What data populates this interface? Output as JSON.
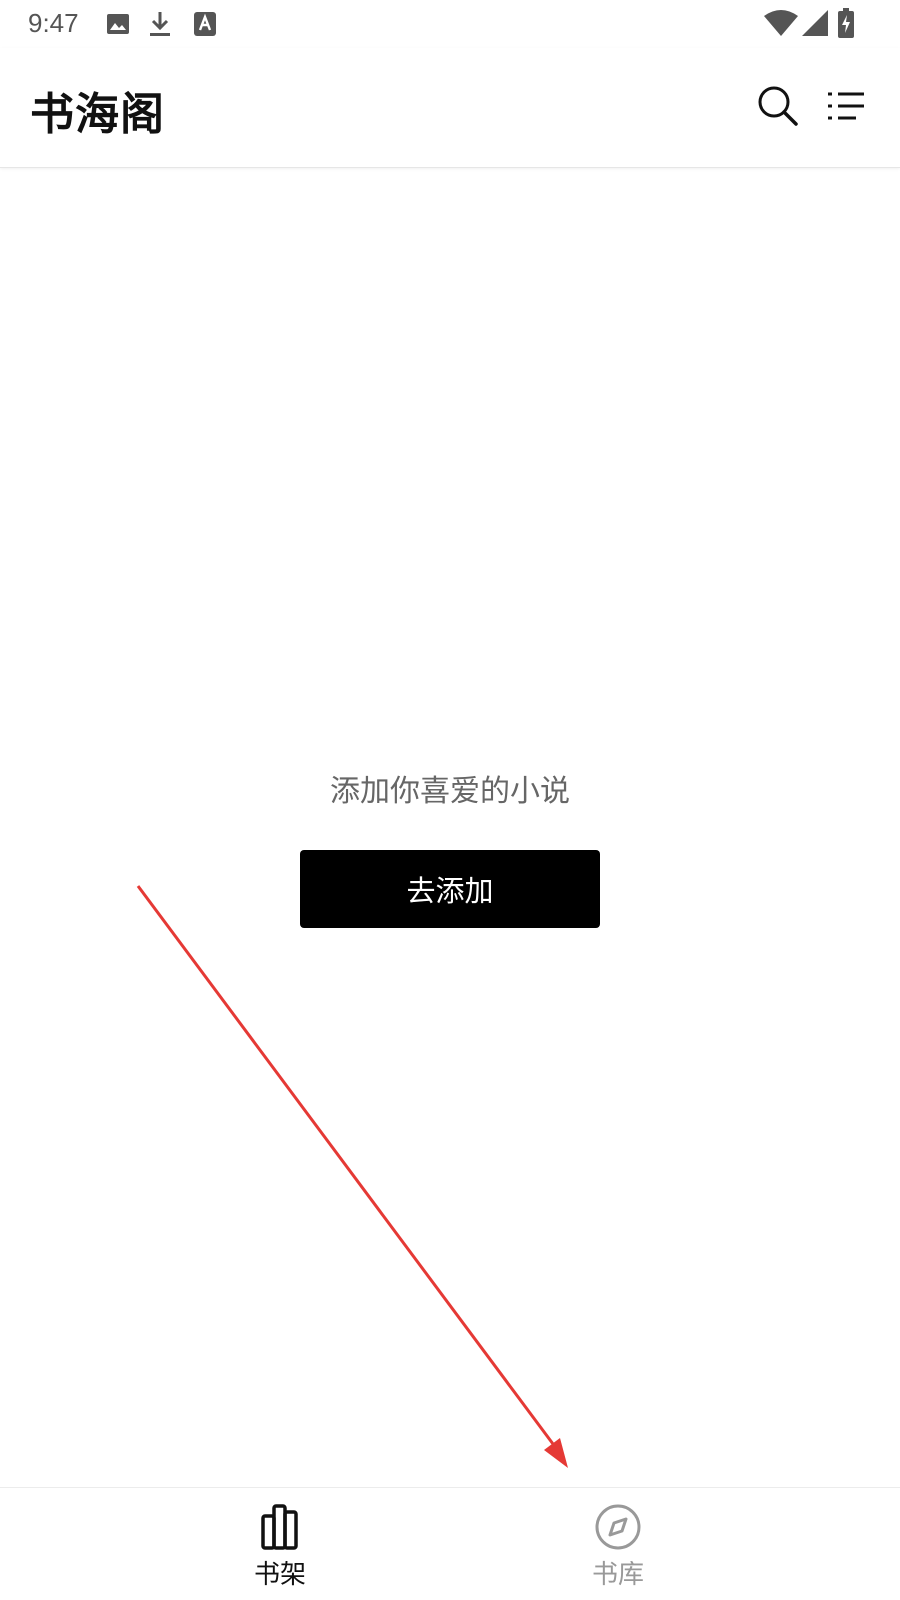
{
  "status_bar": {
    "time": "9:47",
    "icons": [
      "image-icon",
      "download-icon",
      "a-badge-icon",
      "wifi-icon",
      "signal-icon",
      "battery-icon"
    ]
  },
  "header": {
    "title": "书海阁",
    "actions": [
      "search-icon",
      "menu-list-icon"
    ]
  },
  "empty_state": {
    "message": "添加你喜爱的小说",
    "button_label": "去添加"
  },
  "bottom_nav": {
    "tabs": [
      {
        "label": "书架",
        "icon": "bookshelf-icon",
        "active": true
      },
      {
        "label": "书库",
        "icon": "compass-icon",
        "active": false
      }
    ],
    "active_color": "#111111",
    "inactive_color": "#999999"
  },
  "annotation": {
    "color": "#e53935"
  }
}
